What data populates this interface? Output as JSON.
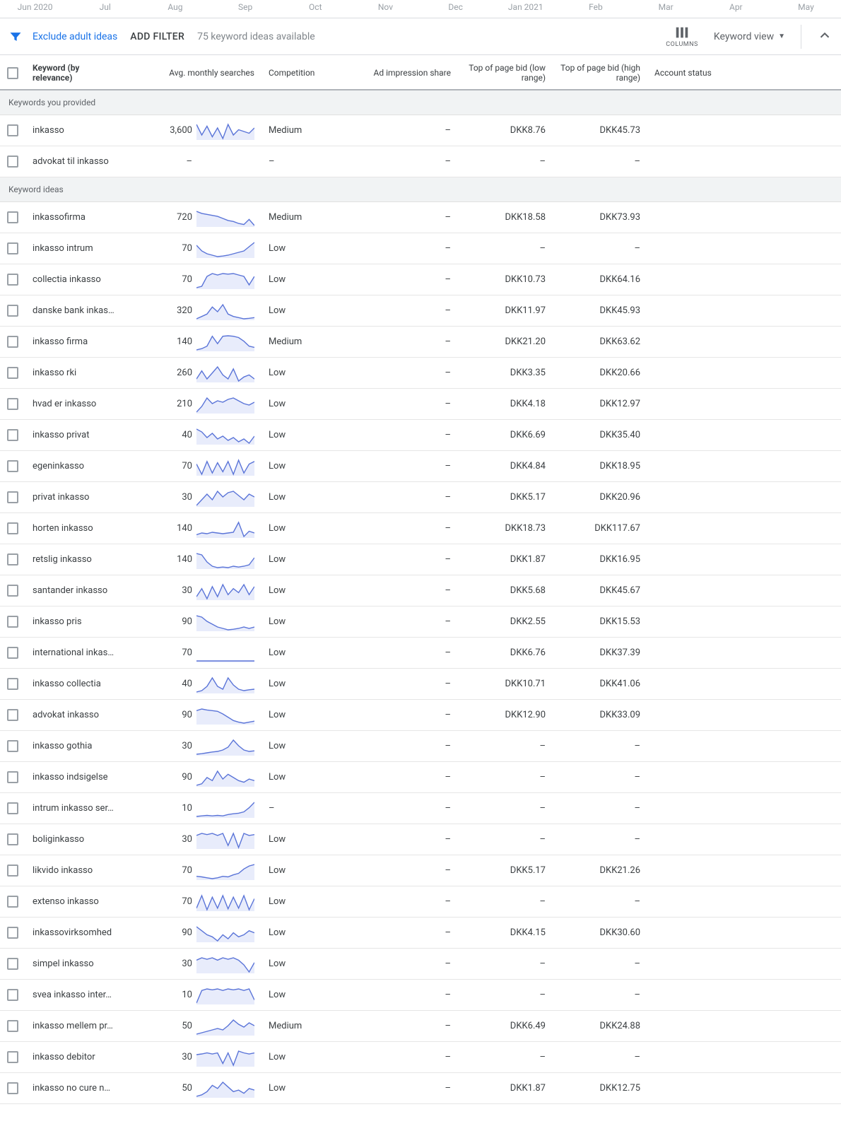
{
  "timeline": [
    "Jun 2020",
    "Jul",
    "Aug",
    "Sep",
    "Oct",
    "Nov",
    "Dec",
    "Jan 2021",
    "Feb",
    "Mar",
    "Apr",
    "May"
  ],
  "toolbar": {
    "exclude": "Exclude adult ideas",
    "add_filter": "ADD FILTER",
    "available": "75 keyword ideas available",
    "columns": "COLUMNS",
    "view": "Keyword view"
  },
  "headers": {
    "keyword": "Keyword (by relevance)",
    "searches": "Avg. monthly searches",
    "competition": "Competition",
    "impr": "Ad impression share",
    "low": "Top of page bid (low range)",
    "high": "Top of page bid (high range)",
    "account": "Account status"
  },
  "sections": {
    "provided": "Keywords you provided",
    "ideas": "Keyword ideas"
  },
  "provided": [
    {
      "keyword": "inkasso",
      "searches": "3,600",
      "competition": "Medium",
      "impr": "–",
      "low": "DKK8.76",
      "high": "DKK45.73",
      "spark": [
        70,
        40,
        65,
        35,
        60,
        30,
        70,
        40,
        55,
        50,
        45,
        60
      ]
    },
    {
      "keyword": "advokat til inkasso",
      "searches": "–",
      "competition": "–",
      "impr": "–",
      "low": "–",
      "high": "–",
      "spark": null
    }
  ],
  "ideas": [
    {
      "keyword": "inkassofirma",
      "searches": "720",
      "competition": "Medium",
      "impr": "–",
      "low": "DKK18.58",
      "high": "DKK73.93",
      "spark": [
        80,
        70,
        65,
        60,
        55,
        45,
        35,
        30,
        20,
        15,
        40,
        10
      ]
    },
    {
      "keyword": "inkasso intrum",
      "searches": "70",
      "competition": "Low",
      "impr": "–",
      "low": "–",
      "high": "–",
      "spark": [
        60,
        40,
        30,
        25,
        20,
        22,
        25,
        30,
        35,
        40,
        55,
        70
      ]
    },
    {
      "keyword": "collectia inkasso",
      "searches": "70",
      "competition": "Low",
      "impr": "–",
      "low": "DKK10.73",
      "high": "DKK64.16",
      "spark": [
        20,
        25,
        60,
        70,
        65,
        70,
        68,
        70,
        65,
        60,
        30,
        60
      ]
    },
    {
      "keyword": "danske bank inkas…",
      "searches": "320",
      "competition": "Low",
      "impr": "–",
      "low": "DKK11.97",
      "high": "DKK45.93",
      "spark": [
        20,
        30,
        40,
        70,
        50,
        80,
        40,
        30,
        25,
        20,
        22,
        25
      ]
    },
    {
      "keyword": "inkasso firma",
      "searches": "140",
      "competition": "Medium",
      "impr": "–",
      "low": "DKK21.20",
      "high": "DKK63.62",
      "spark": [
        15,
        20,
        30,
        70,
        40,
        70,
        72,
        70,
        65,
        50,
        30,
        25
      ]
    },
    {
      "keyword": "inkasso rki",
      "searches": "260",
      "competition": "Low",
      "impr": "–",
      "low": "DKK3.35",
      "high": "DKK20.66",
      "spark": [
        40,
        60,
        40,
        55,
        70,
        50,
        40,
        65,
        35,
        45,
        50,
        40
      ]
    },
    {
      "keyword": "hvad er inkasso",
      "searches": "210",
      "competition": "Low",
      "impr": "–",
      "low": "DKK4.18",
      "high": "DKK12.97",
      "spark": [
        20,
        40,
        70,
        50,
        60,
        55,
        65,
        70,
        60,
        50,
        45,
        55
      ]
    },
    {
      "keyword": "inkasso privat",
      "searches": "40",
      "competition": "Low",
      "impr": "–",
      "low": "DKK6.69",
      "high": "DKK35.40",
      "spark": [
        70,
        60,
        40,
        55,
        35,
        45,
        30,
        40,
        25,
        35,
        20,
        45
      ]
    },
    {
      "keyword": "egeninkasso",
      "searches": "70",
      "competition": "Low",
      "impr": "–",
      "low": "DKK4.84",
      "high": "DKK18.95",
      "spark": [
        60,
        20,
        70,
        25,
        65,
        30,
        70,
        20,
        75,
        25,
        60,
        70
      ]
    },
    {
      "keyword": "privat inkasso",
      "searches": "30",
      "competition": "Low",
      "impr": "–",
      "low": "DKK5.17",
      "high": "DKK20.96",
      "spark": [
        20,
        40,
        60,
        40,
        70,
        50,
        65,
        70,
        55,
        40,
        60,
        50
      ]
    },
    {
      "keyword": "horten inkasso",
      "searches": "140",
      "competition": "Low",
      "impr": "–",
      "low": "DKK18.73",
      "high": "DKK117.67",
      "spark": [
        35,
        40,
        38,
        42,
        40,
        38,
        40,
        42,
        70,
        30,
        45,
        40
      ]
    },
    {
      "keyword": "retslig inkasso",
      "searches": "140",
      "competition": "Low",
      "impr": "–",
      "low": "DKK1.87",
      "high": "DKK16.95",
      "spark": [
        70,
        65,
        40,
        25,
        20,
        22,
        20,
        25,
        22,
        25,
        30,
        55
      ]
    },
    {
      "keyword": "santander inkasso",
      "searches": "30",
      "competition": "Low",
      "impr": "–",
      "low": "DKK5.68",
      "high": "DKK45.67",
      "spark": [
        40,
        60,
        35,
        65,
        40,
        70,
        45,
        60,
        50,
        70,
        45,
        65
      ]
    },
    {
      "keyword": "inkasso pris",
      "searches": "90",
      "competition": "Low",
      "impr": "–",
      "low": "DKK2.55",
      "high": "DKK15.53",
      "spark": [
        70,
        65,
        50,
        40,
        30,
        25,
        20,
        22,
        25,
        30,
        25,
        30
      ]
    },
    {
      "keyword": "international inkas…",
      "searches": "70",
      "competition": "Low",
      "impr": "–",
      "low": "DKK6.76",
      "high": "DKK37.39",
      "spark": [
        30,
        30,
        30,
        30,
        30,
        30,
        30,
        30,
        30,
        30,
        30,
        30
      ]
    },
    {
      "keyword": "inkasso collectia",
      "searches": "40",
      "competition": "Low",
      "impr": "–",
      "low": "DKK10.71",
      "high": "DKK41.06",
      "spark": [
        20,
        25,
        40,
        70,
        40,
        30,
        70,
        45,
        30,
        25,
        28,
        30
      ]
    },
    {
      "keyword": "advokat inkasso",
      "searches": "90",
      "competition": "Low",
      "impr": "–",
      "low": "DKK12.90",
      "high": "DKK33.09",
      "spark": [
        60,
        65,
        62,
        60,
        58,
        50,
        40,
        30,
        25,
        22,
        25,
        28
      ]
    },
    {
      "keyword": "inkasso gothia",
      "searches": "30",
      "competition": "Low",
      "impr": "–",
      "low": "–",
      "high": "–",
      "spark": [
        20,
        22,
        25,
        28,
        30,
        35,
        45,
        70,
        50,
        35,
        30,
        32
      ]
    },
    {
      "keyword": "inkasso indsigelse",
      "searches": "90",
      "competition": "Low",
      "impr": "–",
      "low": "–",
      "high": "–",
      "spark": [
        25,
        30,
        50,
        40,
        70,
        45,
        60,
        50,
        40,
        35,
        45,
        40
      ]
    },
    {
      "keyword": "intrum inkasso ser…",
      "searches": "10",
      "competition": "–",
      "impr": "–",
      "low": "–",
      "high": "–",
      "spark": [
        18,
        20,
        22,
        20,
        22,
        20,
        25,
        28,
        30,
        35,
        50,
        70
      ]
    },
    {
      "keyword": "boliginkasso",
      "searches": "30",
      "competition": "Low",
      "impr": "–",
      "low": "–",
      "high": "–",
      "spark": [
        50,
        55,
        52,
        55,
        50,
        55,
        25,
        55,
        20,
        55,
        50,
        52
      ]
    },
    {
      "keyword": "likvido inkasso",
      "searches": "70",
      "competition": "Low",
      "impr": "–",
      "low": "DKK5.17",
      "high": "DKK21.26",
      "spark": [
        30,
        28,
        25,
        22,
        25,
        30,
        28,
        35,
        40,
        55,
        65,
        70
      ]
    },
    {
      "keyword": "extenso inkasso",
      "searches": "70",
      "competition": "Low",
      "impr": "–",
      "low": "–",
      "high": "–",
      "spark": [
        30,
        70,
        25,
        65,
        30,
        70,
        28,
        65,
        30,
        70,
        25,
        60
      ]
    },
    {
      "keyword": "inkassovirksomhed",
      "searches": "90",
      "competition": "Low",
      "impr": "–",
      "low": "DKK4.15",
      "high": "DKK30.60",
      "spark": [
        60,
        50,
        40,
        35,
        25,
        40,
        30,
        45,
        35,
        40,
        50,
        45
      ]
    },
    {
      "keyword": "simpel inkasso",
      "searches": "30",
      "competition": "Low",
      "impr": "–",
      "low": "–",
      "high": "–",
      "spark": [
        50,
        55,
        52,
        55,
        50,
        55,
        52,
        55,
        50,
        40,
        25,
        45
      ]
    },
    {
      "keyword": "svea inkasso inter…",
      "searches": "10",
      "competition": "Low",
      "impr": "–",
      "low": "–",
      "high": "–",
      "spark": [
        20,
        60,
        65,
        62,
        65,
        60,
        65,
        62,
        65,
        60,
        65,
        30
      ]
    },
    {
      "keyword": "inkasso mellem pr…",
      "searches": "50",
      "competition": "Medium",
      "impr": "–",
      "low": "DKK6.49",
      "high": "DKK24.88",
      "spark": [
        20,
        25,
        30,
        35,
        40,
        35,
        50,
        70,
        55,
        45,
        60,
        50
      ]
    },
    {
      "keyword": "inkasso debitor",
      "searches": "30",
      "competition": "Low",
      "impr": "–",
      "low": "–",
      "high": "–",
      "spark": [
        50,
        52,
        55,
        52,
        55,
        25,
        55,
        20,
        60,
        55,
        52,
        55
      ]
    },
    {
      "keyword": "inkasso no cure n…",
      "searches": "50",
      "competition": "Low",
      "impr": "–",
      "low": "DKK1.87",
      "high": "DKK12.75",
      "spark": [
        25,
        30,
        40,
        60,
        50,
        70,
        55,
        40,
        45,
        35,
        50,
        45
      ]
    }
  ]
}
